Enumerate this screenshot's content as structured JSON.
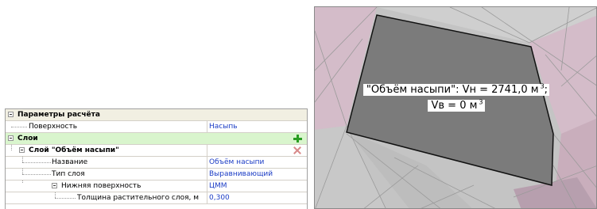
{
  "grid": {
    "header": "Параметры расчёта",
    "surface": {
      "label": "Поверхность",
      "value": "Насыпь"
    },
    "layers_group": "Слои",
    "layer_title": "Слой \"Объём насыпи\"",
    "name": {
      "label": "Название",
      "value": "Объём насыпи"
    },
    "layer_type": {
      "label": "Тип слоя",
      "value": "Выравнивающий"
    },
    "lower_surface": {
      "label": "Нижняя поверхность",
      "value": "ЦММ"
    },
    "topsoil": {
      "label": "Толщина растительного слоя, м",
      "value": "0,300"
    },
    "icons": {
      "add": "plus-icon",
      "delete": "cross-icon",
      "collapse": "minus-box-icon"
    }
  },
  "viewport": {
    "label_line1": "\"Объём насыпи\": Vн = 2741,0 м",
    "label_line2": "Vв = 0 м",
    "unit_power": "3",
    "colors": {
      "fill_area": "#7b7b7b",
      "pink": "#d1b8c5",
      "grey_tri": "#c2c2c2"
    }
  }
}
